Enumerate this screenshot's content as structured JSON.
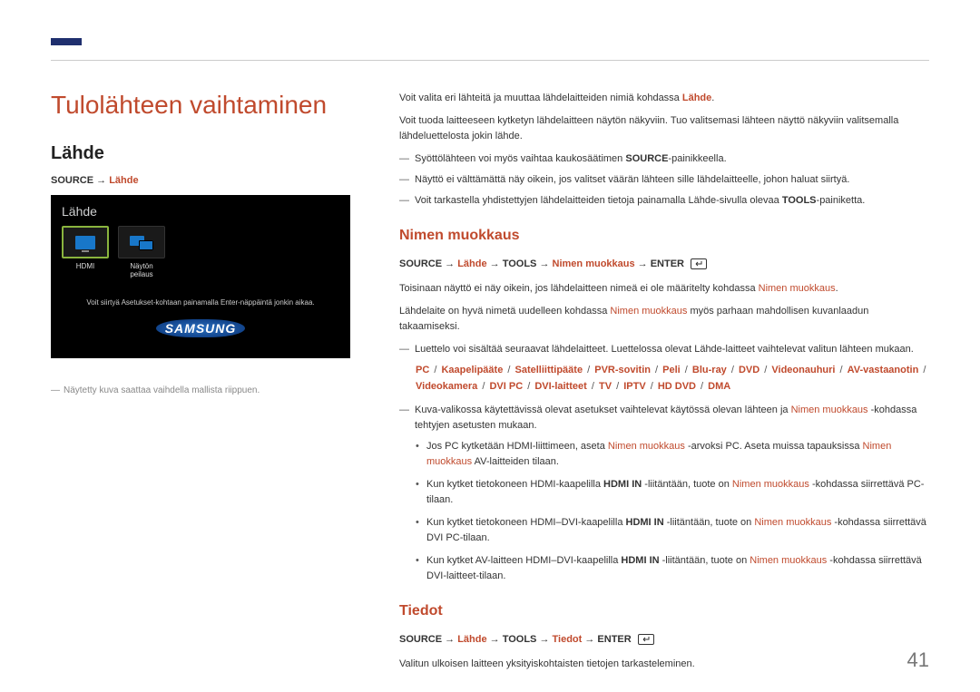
{
  "page_number": "41",
  "left": {
    "section_title": "Tulolähteen vaihtaminen",
    "subheading": "Lähde",
    "path_prefix": "SOURCE → ",
    "path_red": "Lähde",
    "screenshot": {
      "title": "Lähde",
      "src1_label": "HDMI",
      "src2_label": "Näytön peilaus",
      "hint": "Voit siirtyä Asetukset-kohtaan painamalla Enter-näppäintä jonkin aikaa.",
      "brand": "SAMSUNG"
    },
    "caption_dash": "―",
    "caption": "Näytetty kuva saattaa vaihdella mallista riippuen."
  },
  "right": {
    "p1_a": "Voit valita eri lähteitä ja muuttaa lähdelaitteiden nimiä kohdassa ",
    "p1_b": "Lähde",
    "p1_c": ".",
    "p2": "Voit tuoda laitteeseen kytketyn lähdelaitteen näytön näkyviin. Tuo valitsemasi lähteen näyttö näkyviin valitsemalla lähdeluettelosta jokin lähde.",
    "n1_a": "Syöttölähteen voi myös vaihtaa kaukosäätimen ",
    "n1_b": "SOURCE",
    "n1_c": "-painikkeella.",
    "n2": "Näyttö ei välttämättä näy oikein, jos valitset väärän lähteen sille lähdelaitteelle, johon haluat siirtyä.",
    "n3_a": "Voit tarkastella yhdistettyjen lähdelaitteiden tietoja painamalla ",
    "n3_b": "Lähde",
    "n3_c": "-sivulla olevaa ",
    "n3_d": "TOOLS",
    "n3_e": "-painiketta.",
    "h_nimen": "Nimen muokkaus",
    "nimen_path_a": "SOURCE → ",
    "nimen_path_b": "Lähde",
    "nimen_path_c": " → TOOLS → ",
    "nimen_path_d": "Nimen muokkaus",
    "nimen_path_e": " → ENTER",
    "nm_p1_a": "Toisinaan näyttö ei näy oikein, jos lähdelaitteen nimeä ei ole määritelty kohdassa ",
    "nm_p1_b": "Nimen muokkaus",
    "nm_p1_c": ".",
    "nm_p2_a": "Lähdelaite on hyvä nimetä uudelleen kohdassa ",
    "nm_p2_b": "Nimen muokkaus",
    "nm_p2_c": " myös parhaan mahdollisen kuvanlaadun takaamiseksi.",
    "nm_n1_a": "Luettelo voi sisältää seuraavat lähdelaitteet. Luettelossa olevat ",
    "nm_n1_b": "Lähde",
    "nm_n1_c": "-laitteet vaihtelevat valitun lähteen mukaan.",
    "devices": [
      "PC",
      "Kaapelipääte",
      "Satelliittipääte",
      "PVR-sovitin",
      "Peli",
      "Blu-ray",
      "DVD",
      "Videonauhuri",
      "AV-vastaanotin",
      "Videokamera",
      "DVI PC",
      "DVI-laitteet",
      "TV",
      "IPTV",
      "HD DVD",
      "DMA"
    ],
    "nm_n2_a": "Kuva",
    "nm_n2_b": "-valikossa käytettävissä olevat asetukset vaihtelevat käytössä olevan lähteen ja ",
    "nm_n2_c": "Nimen muokkaus",
    "nm_n2_d": " -kohdassa tehtyjen asetusten mukaan.",
    "b1_a": "Jos PC kytketään HDMI-liittimeen, aseta ",
    "b1_b": "Nimen muokkaus",
    "b1_c": " -arvoksi ",
    "b1_d": "PC",
    "b1_e": ". Aseta muissa tapauksissa ",
    "b1_f": "Nimen muokkaus",
    "b1_g": " AV-laitteiden tilaan.",
    "b2_a": "Kun kytket tietokoneen HDMI-kaapelilla ",
    "b2_b": "HDMI IN",
    "b2_c": " -liitäntään, tuote on ",
    "b2_d": "Nimen muokkaus",
    "b2_e": " -kohdassa siirrettävä ",
    "b2_f": "PC",
    "b2_g": "-tilaan.",
    "b3_a": "Kun kytket tietokoneen HDMI–DVI-kaapelilla ",
    "b3_b": "HDMI IN",
    "b3_c": " -liitäntään, tuote on ",
    "b3_d": "Nimen muokkaus",
    "b3_e": " -kohdassa siirrettävä ",
    "b3_f": "DVI PC",
    "b3_g": "-tilaan.",
    "b4_a": "Kun kytket AV-laitteen HDMI–DVI-kaapelilla ",
    "b4_b": "HDMI IN",
    "b4_c": " -liitäntään, tuote on ",
    "b4_d": "Nimen muokkaus",
    "b4_e": " -kohdassa siirrettävä ",
    "b4_f": "DVI-laitteet",
    "b4_g": "-tilaan.",
    "h_tiedot": "Tiedot",
    "tiedot_path_a": "SOURCE → ",
    "tiedot_path_b": "Lähde",
    "tiedot_path_c": " → TOOLS → ",
    "tiedot_path_d": "Tiedot",
    "tiedot_path_e": " → ENTER",
    "tiedot_p": "Valitun ulkoisen laitteen yksityiskohtaisten tietojen tarkasteleminen."
  }
}
